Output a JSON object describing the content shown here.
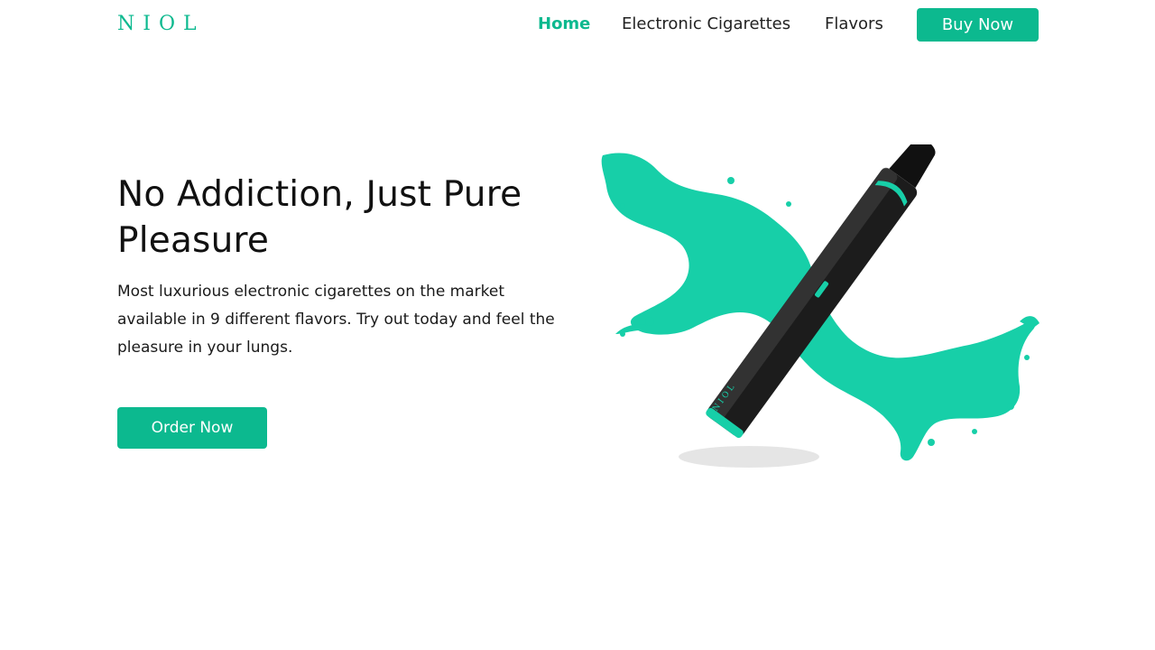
{
  "brand": {
    "logo_text": "NIOL",
    "accent_color": "#0cb98f"
  },
  "nav": {
    "items": [
      {
        "label": "Home",
        "active": true
      },
      {
        "label": "Electronic Cigarettes",
        "active": false
      },
      {
        "label": "Flavors",
        "active": false
      }
    ],
    "cta_label": "Buy Now"
  },
  "hero": {
    "title": "No Addiction, Just Pure Pleasure",
    "description": "Most luxurious electronic cigarettes on the market available in 9 different flavors. Try out today and feel the pleasure in your lungs.",
    "cta_label": "Order Now",
    "product_image": {
      "icon": "vape-pen-with-splash",
      "device_label": "NIOL",
      "splash_color": "#17cfa8",
      "device_color": "#1c1c1c"
    }
  }
}
